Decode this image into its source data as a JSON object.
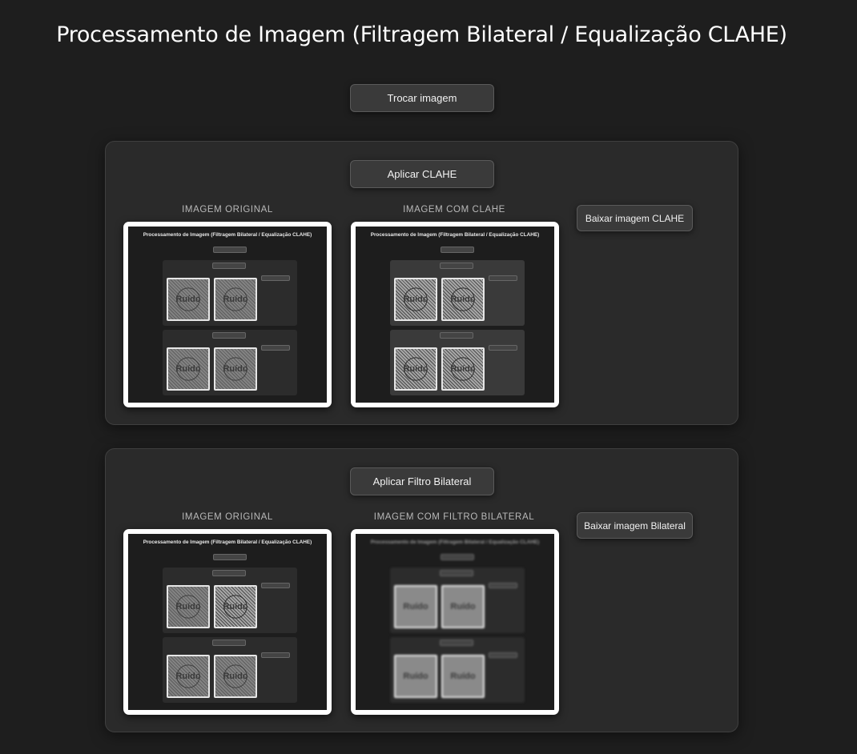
{
  "page": {
    "title": "Processamento de Imagem (Filtragem Bilateral / Equalização CLAHE)"
  },
  "toolbar": {
    "swap_image_label": "Trocar imagem"
  },
  "clahe_panel": {
    "apply_label": "Aplicar CLAHE",
    "original_label": "IMAGEM ORIGINAL",
    "result_label": "IMAGEM COM CLAHE",
    "download_label": "Baixar imagem CLAHE"
  },
  "bilateral_panel": {
    "apply_label": "Aplicar Filtro Bilateral",
    "original_label": "IMAGEM ORIGINAL",
    "result_label": "IMAGEM COM FILTRO BILATERAL",
    "download_label": "Baixar imagem Bilateral"
  },
  "thumbnail": {
    "title": "Processamento de Imagem (Filtragem Bilateral / Equalização CLAHE)",
    "noise_word": "Ruído"
  },
  "colors": {
    "background": "#1e1e1e",
    "panel": "#2a2a2a",
    "button": "#3a3a3a"
  }
}
